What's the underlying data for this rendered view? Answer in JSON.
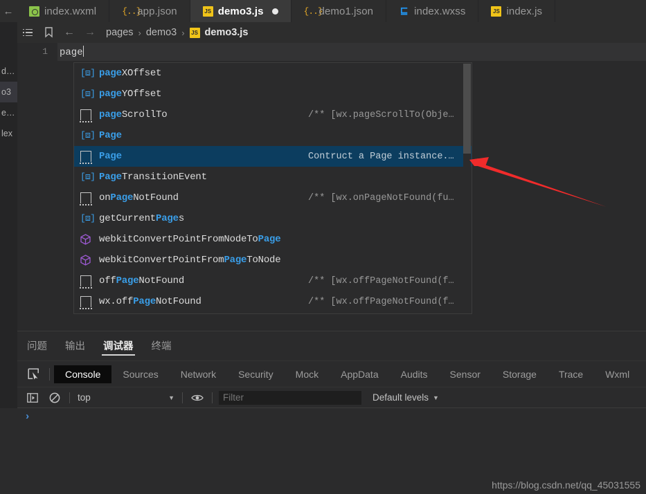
{
  "window": {
    "watermark": "https://blog.csdn.net/qq_45031555"
  },
  "tabbar": {
    "back_icon": "arrow-left-icon",
    "tabs": [
      {
        "label": "index.wxml",
        "icon": "wxml-file-icon",
        "type": "wxml",
        "active": false,
        "dirty": false
      },
      {
        "label": "app.json",
        "icon": "json-file-icon",
        "type": "json",
        "active": false,
        "dirty": false
      },
      {
        "label": "demo3.js",
        "icon": "js-file-icon",
        "type": "js",
        "active": true,
        "dirty": true
      },
      {
        "label": "demo1.json",
        "icon": "json-file-icon",
        "type": "json",
        "active": false,
        "dirty": false
      },
      {
        "label": "index.wxss",
        "icon": "wxss-file-icon",
        "type": "wxss",
        "active": false,
        "dirty": false
      },
      {
        "label": "index.js",
        "icon": "js-file-icon",
        "type": "js",
        "active": false,
        "dirty": false
      }
    ]
  },
  "breadcrumb": {
    "outline_icon": "list-outline-icon",
    "bookmark_icon": "bookmark-icon",
    "back_icon": "arrow-left-icon",
    "forward_icon": "arrow-right-icon",
    "segments": [
      "pages",
      "demo3"
    ],
    "file_icon": "js-file-icon",
    "file": "demo3.js",
    "separator": "›"
  },
  "explorer": {
    "rows": [
      {
        "label": "d…",
        "selected": false
      },
      {
        "label": "o3",
        "selected": true
      },
      {
        "label": "e…",
        "selected": false
      },
      {
        "label": "lex",
        "selected": false
      }
    ]
  },
  "editor": {
    "line_number": "1",
    "line_text": "page"
  },
  "autocomplete": {
    "scrollbar": "vertical-scrollbar",
    "items": [
      {
        "icon": "property-icon",
        "icon_kind": "prop",
        "prefix": "",
        "match": "page",
        "suffix": "XOffset",
        "hint": "",
        "selected": false
      },
      {
        "icon": "property-icon",
        "icon_kind": "prop",
        "prefix": "",
        "match": "page",
        "suffix": "YOffset",
        "hint": "",
        "selected": false
      },
      {
        "icon": "snippet-icon",
        "icon_kind": "sq",
        "prefix": "",
        "match": "page",
        "suffix": "ScrollTo",
        "hint": "/** [wx.pageScrollTo(Obje…",
        "selected": false
      },
      {
        "icon": "property-icon",
        "icon_kind": "prop",
        "prefix": "",
        "match": "Page",
        "suffix": "",
        "hint": "",
        "selected": false
      },
      {
        "icon": "snippet-icon",
        "icon_kind": "sq",
        "prefix": "",
        "match": "Page",
        "suffix": "",
        "hint": "Contruct a Page instance.…",
        "selected": true
      },
      {
        "icon": "property-icon",
        "icon_kind": "prop",
        "prefix": "",
        "match": "Page",
        "suffix": "TransitionEvent",
        "hint": "",
        "selected": false
      },
      {
        "icon": "snippet-icon",
        "icon_kind": "sq",
        "prefix": "on",
        "match": "Page",
        "suffix": "NotFound",
        "hint": "/** [wx.onPageNotFound(fu…",
        "selected": false
      },
      {
        "icon": "property-icon",
        "icon_kind": "prop",
        "prefix": "getCurrent",
        "match": "Page",
        "suffix": "s",
        "hint": "",
        "selected": false
      },
      {
        "icon": "cube-icon",
        "icon_kind": "cube",
        "prefix": "webkitConvertPointFromNodeTo",
        "match": "Page",
        "suffix": "",
        "hint": "",
        "selected": false
      },
      {
        "icon": "cube-icon",
        "icon_kind": "cube",
        "prefix": "webkitConvertPointFrom",
        "match": "Page",
        "suffix": "ToNode",
        "hint": "",
        "selected": false
      },
      {
        "icon": "snippet-icon",
        "icon_kind": "sq",
        "prefix": "off",
        "match": "Page",
        "suffix": "NotFound",
        "hint": "/** [wx.offPageNotFound(f…",
        "selected": false
      },
      {
        "icon": "snippet-icon",
        "icon_kind": "sq",
        "prefix": "wx.off",
        "match": "Page",
        "suffix": "NotFound",
        "hint": "/** [wx.offPageNotFound(f…",
        "selected": false
      }
    ]
  },
  "annotation": {
    "arrow_color": "#f02b2b",
    "name": "red-pointer-arrow"
  },
  "devtools": {
    "panel_tabs": [
      {
        "label": "问题",
        "active": false
      },
      {
        "label": "输出",
        "active": false
      },
      {
        "label": "调试器",
        "active": true
      },
      {
        "label": "终端",
        "active": false
      }
    ],
    "inspect_icon": "inspect-element-icon",
    "tabs": [
      {
        "label": "Console",
        "active": true
      },
      {
        "label": "Sources",
        "active": false
      },
      {
        "label": "Network",
        "active": false
      },
      {
        "label": "Security",
        "active": false
      },
      {
        "label": "Mock",
        "active": false
      },
      {
        "label": "AppData",
        "active": false
      },
      {
        "label": "Audits",
        "active": false
      },
      {
        "label": "Sensor",
        "active": false
      },
      {
        "label": "Storage",
        "active": false
      },
      {
        "label": "Trace",
        "active": false
      },
      {
        "label": "Wxml",
        "active": false
      }
    ],
    "console_toolbar": {
      "sidebar_icon": "console-sidebar-icon",
      "clear_icon": "clear-console-icon",
      "context": "top",
      "context_caret": "▼",
      "eye_icon": "live-expression-eye-icon",
      "filter_value": "",
      "filter_placeholder": "Filter",
      "levels": "Default levels",
      "levels_caret": "▼"
    },
    "console": {
      "prompt": "›"
    }
  },
  "colors": {
    "accent_blue": "#3a9ee8",
    "selection_navy": "#0c3d5f",
    "tab_active_bg": "#3a3a3a",
    "arrow_red": "#f02b2b",
    "js_icon_yellow": "#f0c419",
    "wxml_icon_green": "#8bc34a",
    "json_icon_orange": "#e0a526",
    "cube_purple": "#9b59d0"
  }
}
